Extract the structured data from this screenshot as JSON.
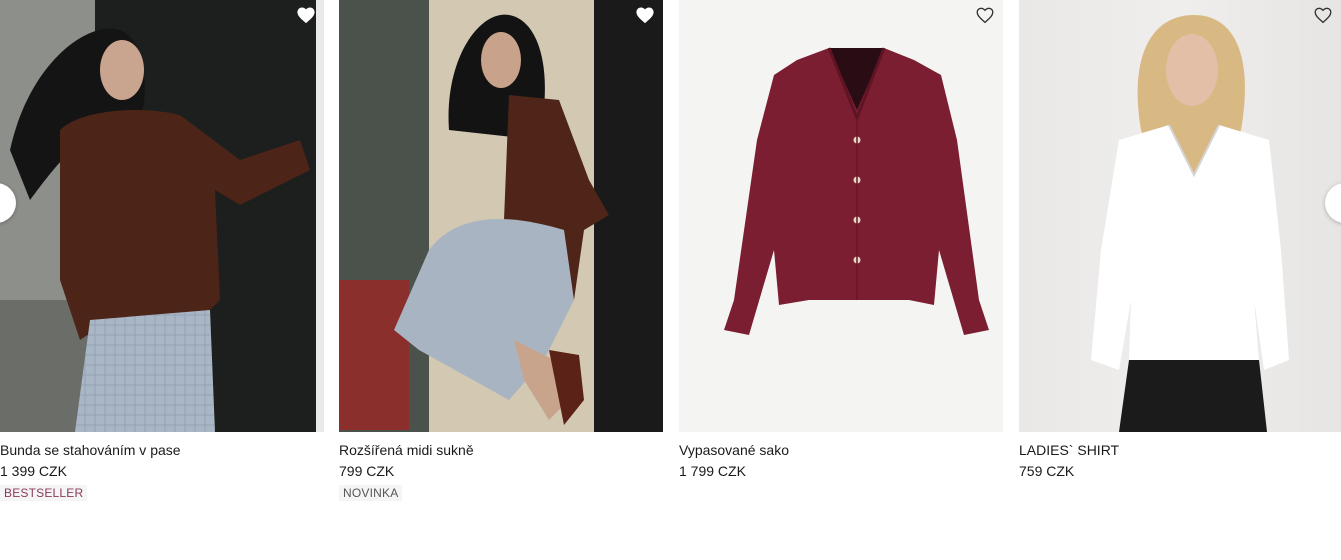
{
  "products": [
    {
      "name": "Bunda se stahováním v pase",
      "price": "1 399 CZK",
      "badge": "BESTSELLER",
      "favorited": true
    },
    {
      "name": "Rozšířená midi sukně",
      "price": "799 CZK",
      "badge": "NOVINKA",
      "favorited": true
    },
    {
      "name": "Vypasované sako",
      "price": "1 799 CZK",
      "badge": "",
      "favorited": false
    },
    {
      "name": "LADIES` SHIRT",
      "price": "759 CZK",
      "badge": "",
      "favorited": false
    }
  ],
  "colors": {
    "badge_bestseller": "#8a3a5c",
    "badge_new": "#555555",
    "blazer": "#7c1e32"
  },
  "icons": [
    "heart-filled-icon",
    "heart-outline-icon",
    "chevron-left-icon",
    "chevron-right-icon"
  ]
}
